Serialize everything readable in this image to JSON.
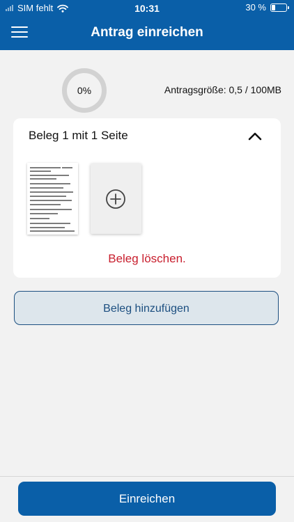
{
  "status_bar": {
    "carrier": "SIM fehlt",
    "time": "10:31",
    "battery_text": "30 %",
    "battery_level": 0.3
  },
  "header": {
    "title": "Antrag einreichen",
    "menu_icon": "hamburger-menu-icon"
  },
  "summary": {
    "progress_label": "0%",
    "progress_value": 0,
    "size_info": "Antragsgröße: 0,5 / 100MB"
  },
  "receipt": {
    "title": "Beleg 1 mit 1 Seite",
    "collapse_icon": "chevron-up-icon",
    "add_page_icon": "plus-circle-icon",
    "delete_label": "Beleg löschen."
  },
  "actions": {
    "add_receipt_label": "Beleg hinzufügen",
    "submit_label": "Einreichen"
  },
  "colors": {
    "brand_blue": "#0a5fa8",
    "delete_red": "#c81e2d",
    "secondary_button_bg": "#dde6ec",
    "page_background": "#f2f2f2"
  }
}
